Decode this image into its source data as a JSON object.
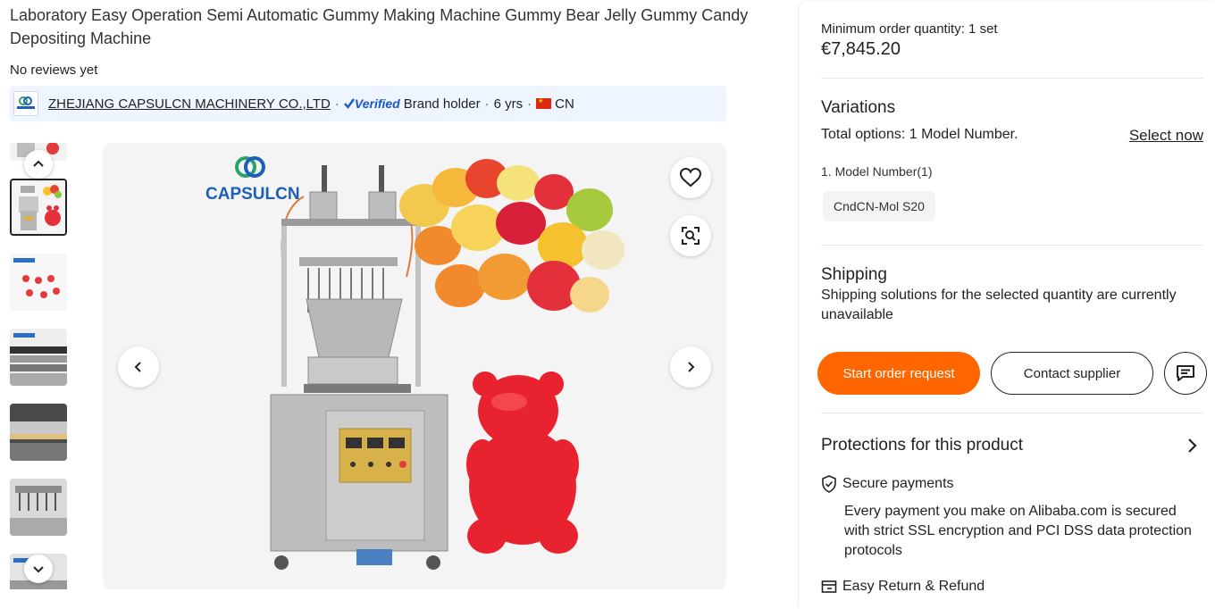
{
  "product": {
    "title": "Laboratory Easy Operation Semi Automatic Gummy Making Machine Gummy Bear Jelly Gummy Candy Depositing Machine",
    "reviews": "No reviews yet"
  },
  "supplier": {
    "name": "ZHEJIANG CAPSULCN MACHINERY CO.,LTD",
    "verified_label": "Verified",
    "brand_holder": "Brand holder",
    "years": "6 yrs",
    "country": "CN",
    "logo_text": "CAPSULCN"
  },
  "gallery": {
    "brand_logo": "CAPSULCN"
  },
  "panel": {
    "min_order": "Minimum order quantity: 1 set",
    "price": "€7,845.20",
    "variations_title": "Variations",
    "total_options": "Total options: 1 Model Number.",
    "select_now": "Select now",
    "model_label": "1. Model Number(1)",
    "model_option": "CndCN-Mol S20",
    "shipping_title": "Shipping",
    "shipping_text": "Shipping solutions for the selected quantity are currently unavailable",
    "start_order": "Start order request",
    "contact_supplier": "Contact supplier",
    "protections_title": "Protections for this product",
    "secure_payments": "Secure payments",
    "secure_desc": "Every payment you make on Alibaba.com is secured with strict SSL encryption and PCI DSS data protection protocols",
    "easy_return": "Easy Return & Refund"
  },
  "colors": {
    "accent": "#ff6600",
    "supplier_bar": "#eef5ff",
    "verified": "#1a56c6"
  }
}
